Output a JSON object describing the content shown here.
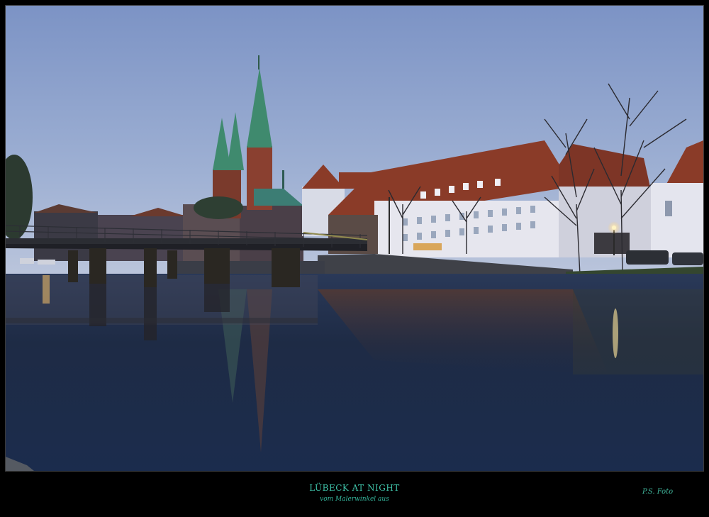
{
  "caption": {
    "title": "LÜBECK AT NIGHT",
    "subtitle": "vom Malerwinkel aus"
  },
  "signature": "P.S. Foto",
  "colors": {
    "frame": "#000000",
    "caption": "#3fc2a8",
    "sky_top": "#7f95c6",
    "sky_bottom": "#b4c2dc",
    "water": "#1c2a43",
    "roof": "#8a3b28",
    "spire": "#3f8a6e",
    "lamp_light": "#ffe9a8"
  }
}
